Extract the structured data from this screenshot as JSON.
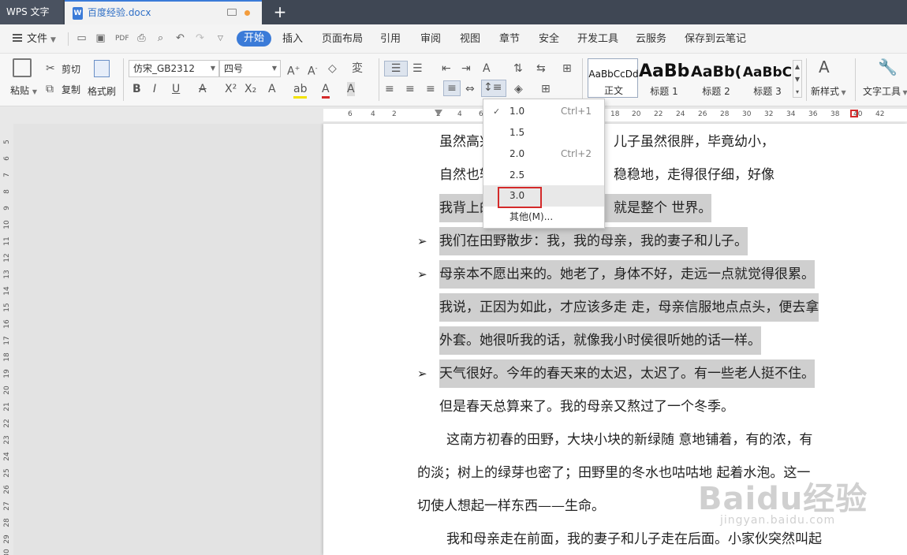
{
  "titlebar": {
    "app_name": "WPS 文字",
    "doc_tab": "百度经验.docx",
    "new_tab": "+"
  },
  "menubar": {
    "file": "文件",
    "items": [
      "开始",
      "插入",
      "页面布局",
      "引用",
      "审阅",
      "视图",
      "章节",
      "安全",
      "开发工具",
      "云服务",
      "保存到云笔记"
    ],
    "active": "开始"
  },
  "ribbon": {
    "paste": "粘贴",
    "cut": "剪切",
    "copy": "复制",
    "format_painter": "格式刷",
    "font_name": "仿宋_GB2312",
    "font_size": "四号",
    "styles": [
      {
        "sample": "AaBbCcDd",
        "name": "正文"
      },
      {
        "sample": "AaBb",
        "name": "标题 1"
      },
      {
        "sample": "AaBb(",
        "name": "标题 2"
      },
      {
        "sample": "AaBbC",
        "name": "标题 3"
      }
    ],
    "new_style": "新样式",
    "text_tools": "文字工具"
  },
  "ruler": {
    "ticks": [
      "6",
      "4",
      "2",
      "2",
      "4",
      "6",
      "18",
      "20",
      "22",
      "24",
      "26",
      "28",
      "30",
      "32",
      "34",
      "36",
      "38",
      "40",
      "42"
    ],
    "vticks": [
      "5",
      "6",
      "7",
      "8",
      "9",
      "10",
      "11",
      "12",
      "13",
      "14",
      "15",
      "16",
      "17",
      "18",
      "19",
      "20",
      "21",
      "22",
      "23",
      "24",
      "25",
      "26",
      "27",
      "28",
      "29",
      "30"
    ]
  },
  "line_spacing_menu": {
    "items": [
      {
        "value": "1.0",
        "shortcut": "Ctrl+1",
        "checked": true
      },
      {
        "value": "1.5",
        "shortcut": ""
      },
      {
        "value": "2.0",
        "shortcut": "Ctrl+2"
      },
      {
        "value": "2.5",
        "shortcut": ""
      },
      {
        "value": "3.0",
        "shortcut": "",
        "highlighted": true
      },
      {
        "value": "其他(M)...",
        "shortcut": ""
      }
    ]
  },
  "document": {
    "lines": [
      "虽然高兴，但也自然不算重；儿子虽然很胖，毕竟幼小，",
      "自然也轻。但我还是慢慢地，稳稳地，走得很仔细，好像",
      "我背上的同她背上的加起来，就是整个 世界。",
      "我们在田野散步：我，我的母亲，我的妻子和儿子。",
      "母亲本不愿出来的。她老了，身体不好，走远一点就觉得很累。",
      "我说，正因为如此，才应该多走 走，母亲信服地点点头，便去拿",
      "外套。她很听我的话，就像我小时侯很听她的话一样。",
      "天气很好。今年的春天来的太迟，太迟了。有一些老人挺不住。",
      "但是春天总算来了。我的母亲又熬过了一个冬季。",
      "这南方初春的田野，大块小块的新绿随 意地铺着，有的浓，有",
      "的淡；树上的绿芽也密了；田野里的冬水也咕咕地 起着水泡。这一",
      "切使人想起一样东西——生命。",
      "我和母亲走在前面，我的妻子和儿子走在后面。小家伙突然叫起"
    ]
  },
  "watermark": {
    "main": "Baidu经验",
    "sub": "jingyan.baidu.com"
  },
  "colors": {
    "titlebar": "#3f4754",
    "accent": "#3b7bd8",
    "highlight": "#cfcfcf",
    "red_box": "#d42a2a"
  }
}
